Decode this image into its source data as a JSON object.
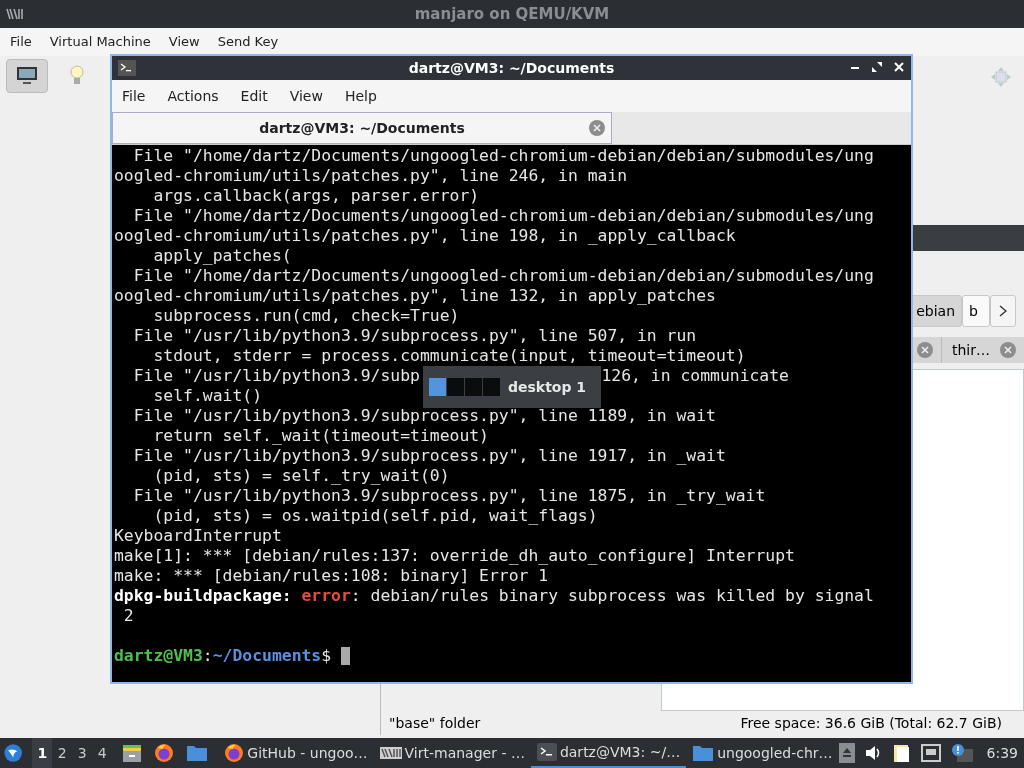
{
  "host_window": {
    "title": "manjaro on QEMU/KVM",
    "menu": [
      "File",
      "Virtual Machine",
      "View",
      "Send Key"
    ],
    "toolbar": [
      {
        "kind": "console",
        "selected": true
      },
      {
        "kind": "details",
        "selected": false
      }
    ]
  },
  "file_manager": {
    "tabs": [
      {
        "label": "ebian",
        "selected": false
      },
      {
        "label": "b",
        "selected": true
      }
    ],
    "tabs_row2": [
      {
        "label": "thir…"
      }
    ],
    "status_left": "\"base\" folder",
    "status_right": "Free space: 36.6 GiB (Total: 62.7 GiB)"
  },
  "terminal": {
    "title": "dartz@VM3: ~/Documents",
    "menu": [
      "File",
      "Actions",
      "Edit",
      "View",
      "Help"
    ],
    "tab": {
      "label": "dartz@VM3: ~/Documents"
    },
    "lines": [
      {
        "segments": [
          {
            "kind": "plain",
            "text": "  File \"/home/dartz/Documents/ungoogled-chromium-debian/debian/submodules/ung"
          }
        ]
      },
      {
        "segments": [
          {
            "kind": "plain",
            "text": "oogled-chromium/utils/patches.py\", line 246, in main"
          }
        ]
      },
      {
        "segments": [
          {
            "kind": "plain",
            "text": "    args.callback(args, parser.error)"
          }
        ]
      },
      {
        "segments": [
          {
            "kind": "plain",
            "text": "  File \"/home/dartz/Documents/ungoogled-chromium-debian/debian/submodules/ung"
          }
        ]
      },
      {
        "segments": [
          {
            "kind": "plain",
            "text": "oogled-chromium/utils/patches.py\", line 198, in _apply_callback"
          }
        ]
      },
      {
        "segments": [
          {
            "kind": "plain",
            "text": "    apply_patches("
          }
        ]
      },
      {
        "segments": [
          {
            "kind": "plain",
            "text": "  File \"/home/dartz/Documents/ungoogled-chromium-debian/debian/submodules/ung"
          }
        ]
      },
      {
        "segments": [
          {
            "kind": "plain",
            "text": "oogled-chromium/utils/patches.py\", line 132, in apply_patches"
          }
        ]
      },
      {
        "segments": [
          {
            "kind": "plain",
            "text": "    subprocess.run(cmd, check=True)"
          }
        ]
      },
      {
        "segments": [
          {
            "kind": "plain",
            "text": "  File \"/usr/lib/python3.9/subprocess.py\", line 507, in run"
          }
        ]
      },
      {
        "segments": [
          {
            "kind": "plain",
            "text": "    stdout, stderr = process.communicate(input, timeout=timeout)"
          }
        ]
      },
      {
        "segments": [
          {
            "kind": "plain",
            "text": "  File \"/usr/lib/python3.9/subp"
          },
          {
            "kind": "after_gap",
            "text": "126, in communicate"
          }
        ]
      },
      {
        "segments": [
          {
            "kind": "plain",
            "text": "    self.wait()"
          }
        ]
      },
      {
        "segments": [
          {
            "kind": "plain",
            "text": "  File \"/usr/lib/python3.9/subprocess.py\", line 1189, in wait"
          }
        ]
      },
      {
        "segments": [
          {
            "kind": "plain",
            "text": "    return self._wait(timeout=timeout)"
          }
        ]
      },
      {
        "segments": [
          {
            "kind": "plain",
            "text": "  File \"/usr/lib/python3.9/subprocess.py\", line 1917, in _wait"
          }
        ]
      },
      {
        "segments": [
          {
            "kind": "plain",
            "text": "    (pid, sts) = self._try_wait(0)"
          }
        ]
      },
      {
        "segments": [
          {
            "kind": "plain",
            "text": "  File \"/usr/lib/python3.9/subprocess.py\", line 1875, in _try_wait"
          }
        ]
      },
      {
        "segments": [
          {
            "kind": "plain",
            "text": "    (pid, sts) = os.waitpid(self.pid, wait_flags)"
          }
        ]
      },
      {
        "segments": [
          {
            "kind": "plain",
            "text": "KeyboardInterrupt"
          }
        ]
      },
      {
        "segments": [
          {
            "kind": "plain",
            "text": "make[1]: *** [debian/rules:137: override_dh_auto_configure] Interrupt"
          }
        ]
      },
      {
        "segments": [
          {
            "kind": "plain",
            "text": "make: *** [debian/rules:108: binary] Error 1"
          }
        ]
      },
      {
        "segments": [
          {
            "kind": "bold",
            "text": "dpkg-buildpackage:"
          },
          {
            "kind": "error",
            "text": " error"
          },
          {
            "kind": "plain",
            "text": ": debian/rules binary subprocess was killed by signal"
          }
        ]
      },
      {
        "segments": [
          {
            "kind": "plain",
            "text": " 2"
          }
        ]
      },
      {
        "prompt": true,
        "segments": [
          {
            "kind": "user",
            "text": "dartz@VM3"
          },
          {
            "kind": "plain",
            "text": ":"
          },
          {
            "kind": "path",
            "text": "~/Documents"
          },
          {
            "kind": "plain",
            "text": "$ "
          }
        ]
      }
    ]
  },
  "desktop_osd": {
    "label": "desktop 1",
    "desktops": [
      {
        "selected": true
      },
      {
        "selected": false
      },
      {
        "selected": false
      },
      {
        "selected": false
      }
    ]
  },
  "taskbar": {
    "workspaces": [
      {
        "label": "1",
        "selected": true
      },
      {
        "label": "2",
        "selected": false
      },
      {
        "label": "3",
        "selected": false
      },
      {
        "label": "4",
        "selected": false
      }
    ],
    "launchers": [
      {
        "kind": "files"
      },
      {
        "kind": "firefox"
      },
      {
        "kind": "folder"
      }
    ],
    "tasks": [
      {
        "kind": "firefox",
        "label": "GitHub - ungoo…",
        "active": false
      },
      {
        "kind": "virt",
        "label": "Virt-manager - …",
        "active": false
      },
      {
        "kind": "terminal",
        "label": "dartz@VM3: ~/…",
        "active": true
      },
      {
        "kind": "folder",
        "label": "ungoogled-chr…",
        "active": false
      }
    ],
    "clock": "6:39"
  }
}
